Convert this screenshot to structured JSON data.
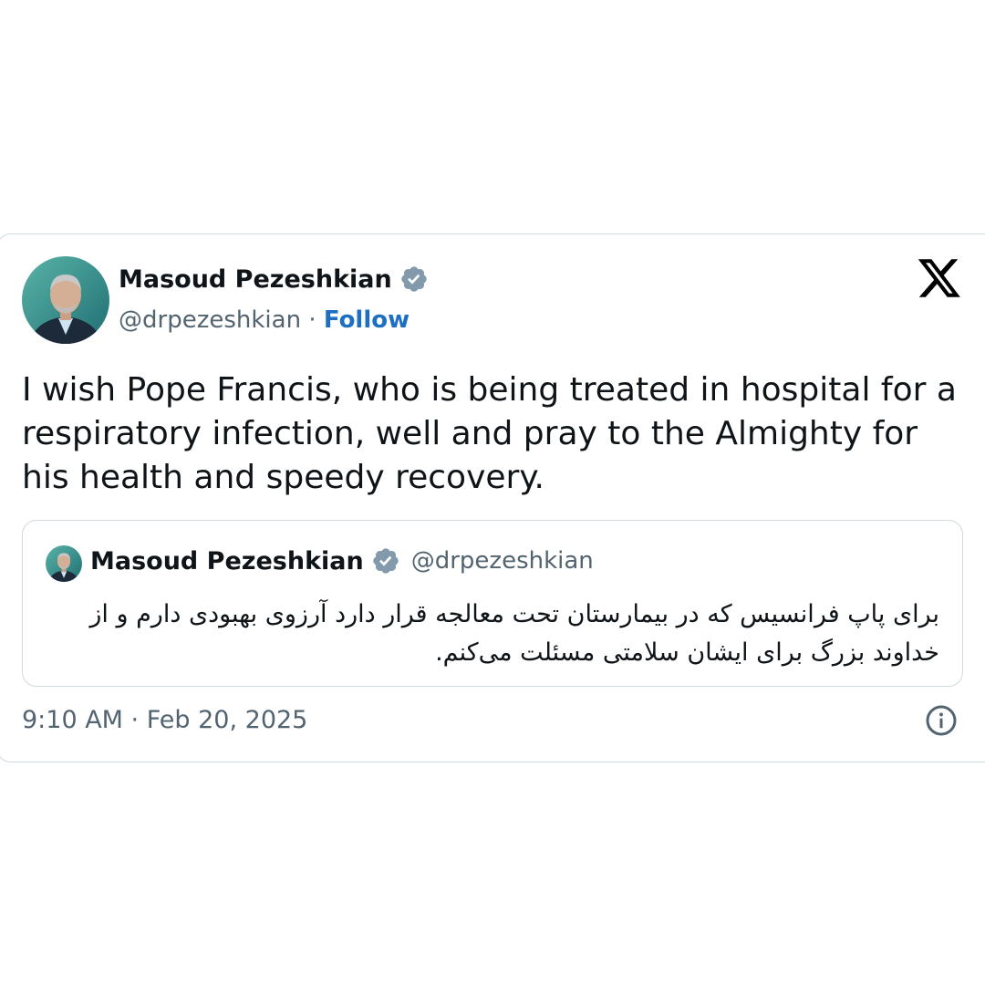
{
  "tweet": {
    "author": {
      "name": "Masoud Pezeshkian",
      "handle": "@drpezeshkian",
      "verified": true
    },
    "separator": " · ",
    "follow_label": "Follow",
    "text": "I wish Pope Francis, who is being treated in hospital for a respiratory infection, well and pray to the Almighty for his health and speedy recovery.",
    "timestamp": "9:10 AM · Feb 20, 2025"
  },
  "quote": {
    "author": {
      "name": "Masoud Pezeshkian",
      "handle": "@drpezeshkian",
      "verified": true
    },
    "text": "برای پاپ فرانسیس که در بیمارستان تحت معالجه قرار دارد آرزوی بهبودی دارم و از خداوند بزرگ برای ایشان سلامتی مسئلت می‌کنم."
  },
  "colors": {
    "text": "#0f1419",
    "secondary_text": "#536471",
    "link": "#1d6fc2",
    "border": "#cfd9de",
    "verified_badge": "#829aab"
  },
  "icons": {
    "brand": "x-logo-icon",
    "verified": "verified-badge-icon",
    "info": "info-icon"
  }
}
